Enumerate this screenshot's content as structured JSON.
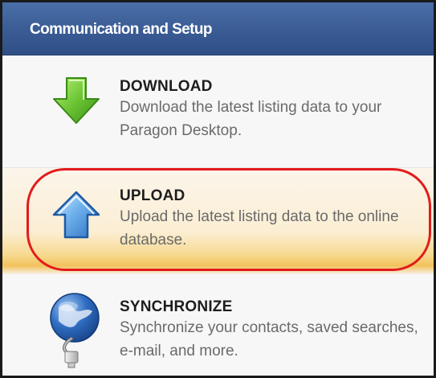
{
  "panel": {
    "title": "Communication and Setup"
  },
  "items": [
    {
      "title": "DOWNLOAD",
      "description": "Download the latest listing data to your Paragon Desktop.",
      "icon": "download-arrow-icon"
    },
    {
      "title": "UPLOAD",
      "description": "Upload the latest listing data to the online database.",
      "icon": "upload-arrow-icon",
      "highlighted": true
    },
    {
      "title": "SYNCHRONIZE",
      "description": "Synchronize your contacts, saved searches, e-mail, and more.",
      "icon": "globe-cable-icon"
    }
  ],
  "colors": {
    "header": "#3a5b94",
    "highlight_ring": "#e31b1b",
    "highlight_band": "#f2c25c",
    "download_arrow": "#5cb82e",
    "upload_arrow": "#4a90d9"
  }
}
